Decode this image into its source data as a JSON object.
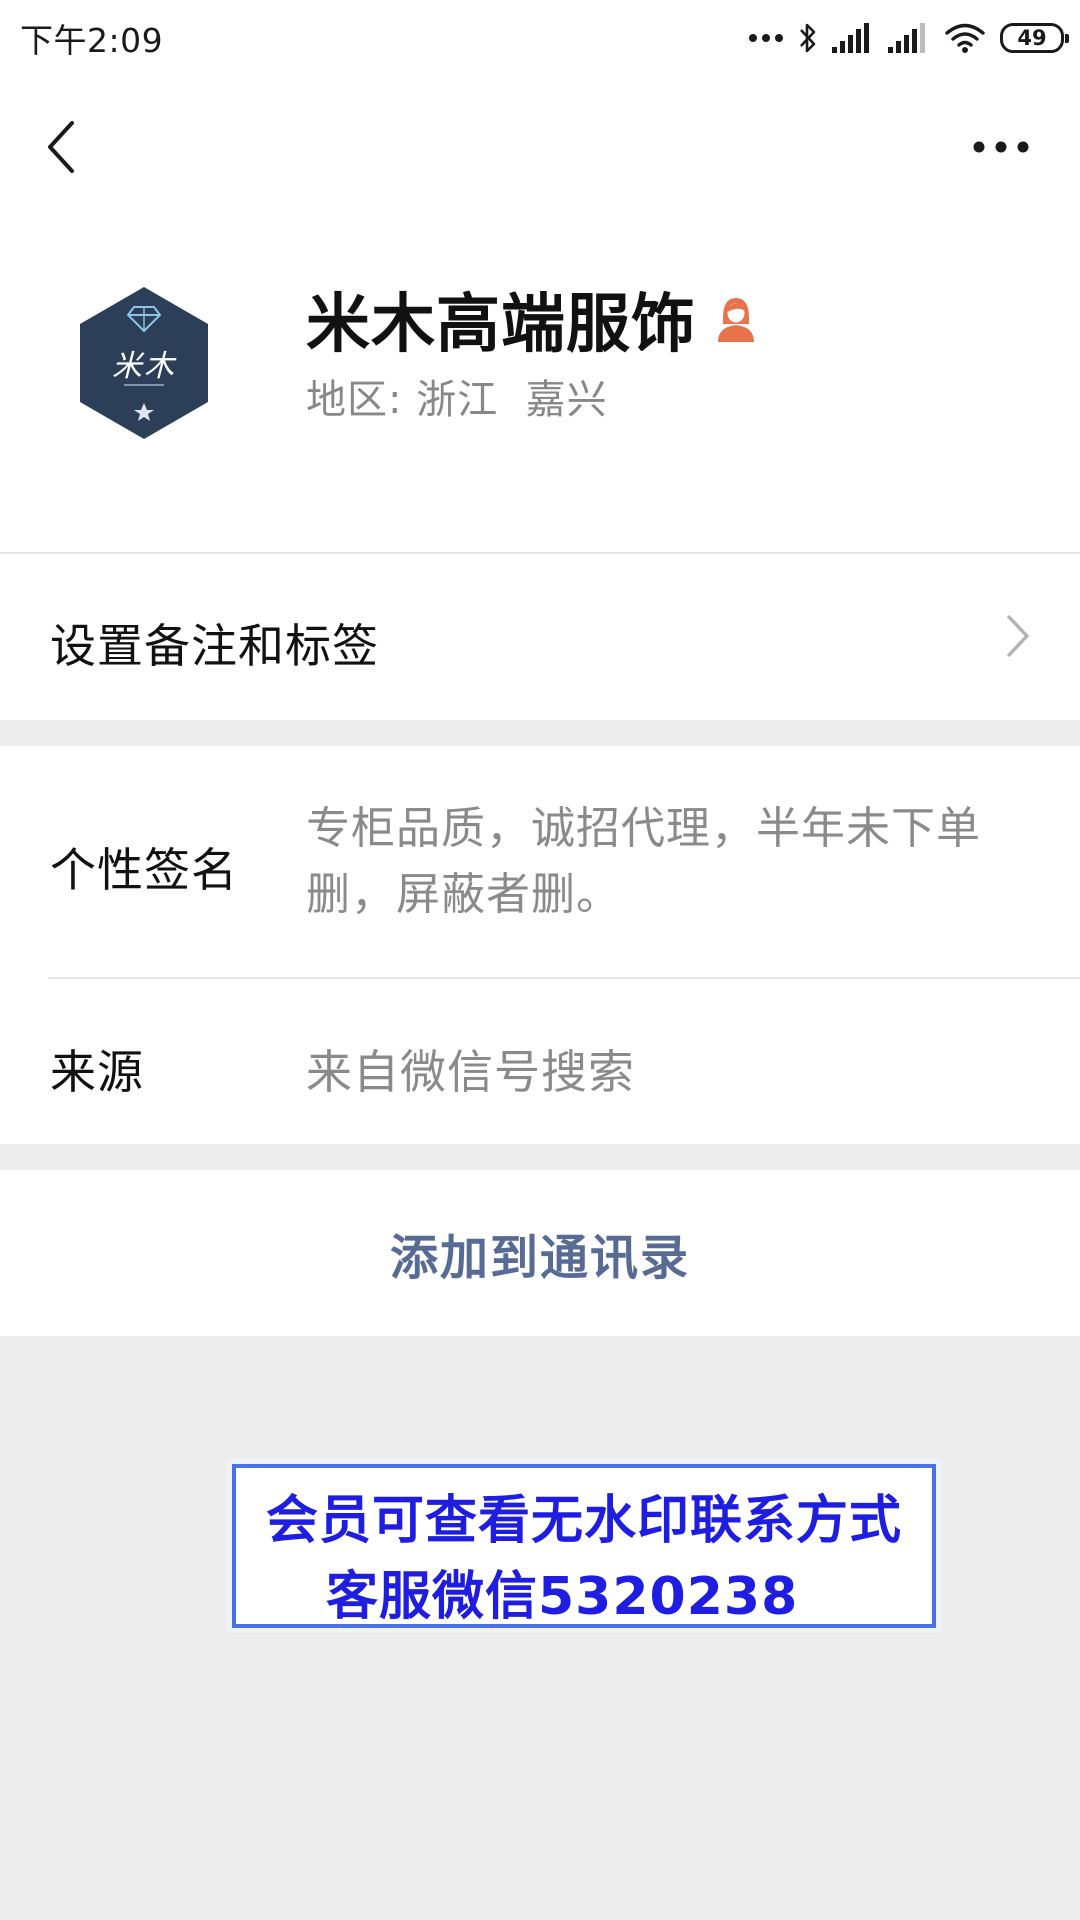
{
  "status_bar": {
    "time": "下午2:09",
    "battery": "49",
    "icons": [
      "more-dots-icon",
      "bluetooth-icon",
      "signal-icon",
      "signal-icon",
      "wifi-icon",
      "battery-icon"
    ]
  },
  "nav": {
    "back_icon": "chevron-left-icon",
    "more_icon": "more-horizontal-icon"
  },
  "profile": {
    "avatar_text": "米木",
    "name": "米木高端服饰",
    "gender_icon": "female-icon",
    "region_label": "地区:",
    "region_value": "浙江  嘉兴"
  },
  "remark": {
    "label": "设置备注和标签"
  },
  "info": {
    "signature_label": "个性签名",
    "signature_value": "专柜品质，诚招代理，半年未下单删，屏蔽者删。",
    "source_label": "来源",
    "source_value": "来自微信号搜索"
  },
  "actions": {
    "add_contact": "添加到通讯录"
  },
  "notice": {
    "line1": "会员可查看无水印联系方式",
    "line2": "客服微信5320238"
  },
  "colors": {
    "background": "#ededed",
    "link": "#576b95",
    "notice_text": "#1f1ee0",
    "notice_border": "#4a72e6",
    "avatar_bg": "#2c3e58",
    "female_icon": "#e8734a"
  }
}
